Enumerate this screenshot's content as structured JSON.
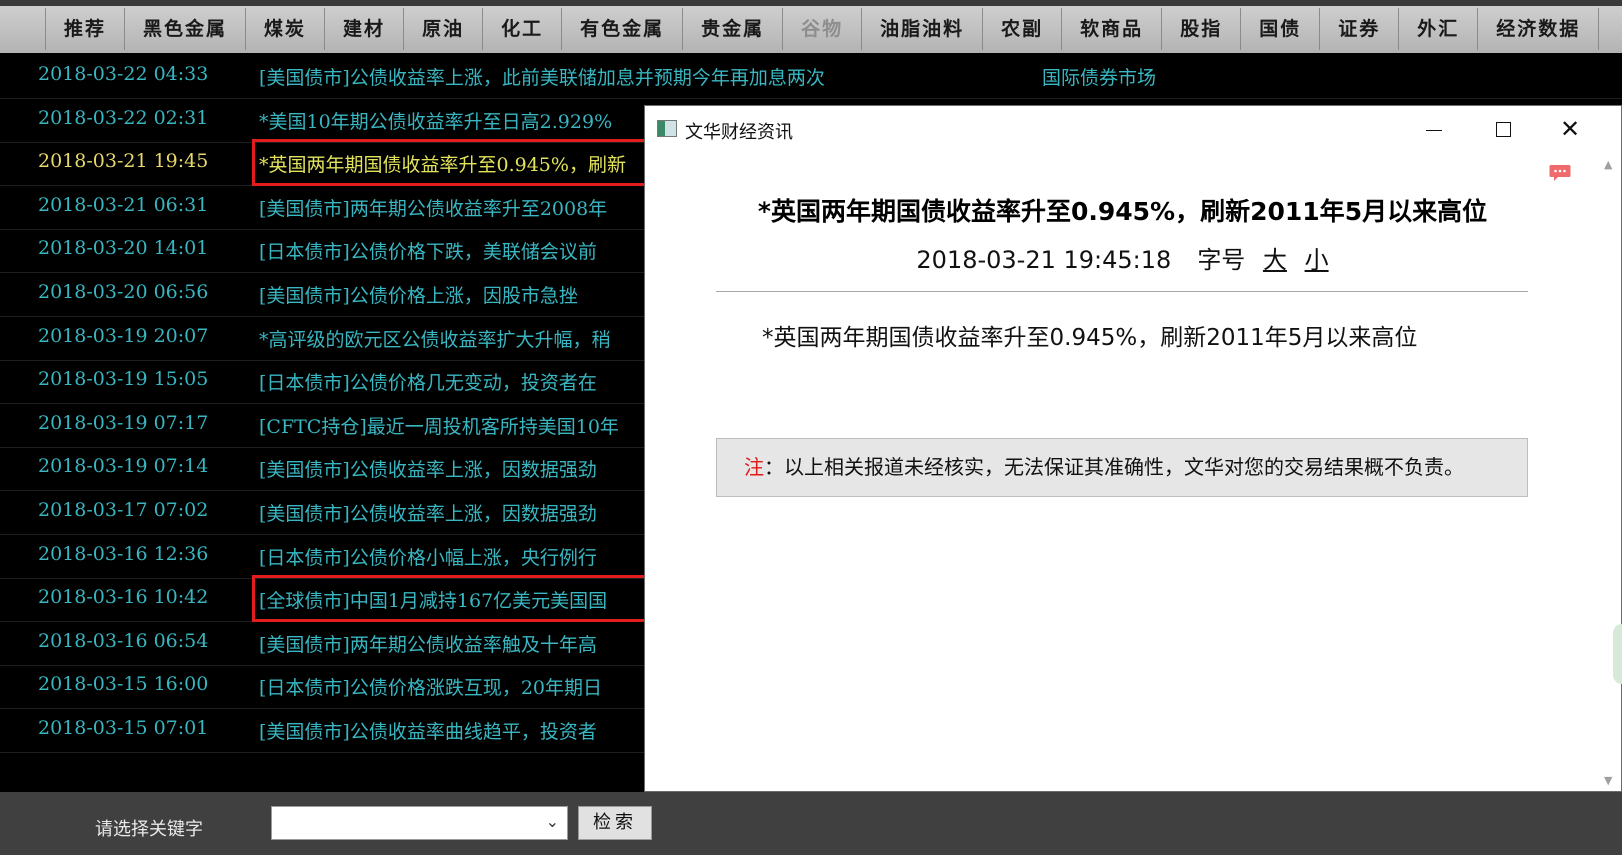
{
  "tabs": [
    {
      "label": "推荐",
      "enabled": true
    },
    {
      "label": "黑色金属",
      "enabled": true
    },
    {
      "label": "煤炭",
      "enabled": true
    },
    {
      "label": "建材",
      "enabled": true
    },
    {
      "label": "原油",
      "enabled": true
    },
    {
      "label": "化工",
      "enabled": true
    },
    {
      "label": "有色金属",
      "enabled": true
    },
    {
      "label": "贵金属",
      "enabled": true
    },
    {
      "label": "谷物",
      "enabled": false
    },
    {
      "label": "油脂油料",
      "enabled": true
    },
    {
      "label": "农副",
      "enabled": true
    },
    {
      "label": "软商品",
      "enabled": true
    },
    {
      "label": "股指",
      "enabled": true
    },
    {
      "label": "国债",
      "enabled": true
    },
    {
      "label": "证券",
      "enabled": true
    },
    {
      "label": "外汇",
      "enabled": true
    },
    {
      "label": "经济数据",
      "enabled": true
    }
  ],
  "news": [
    {
      "time": "2018-03-22 04:33",
      "headline": "[美国债市]公债收益率上涨，此前美联储加息并预期今年再加息两次",
      "category": "国际债券市场"
    },
    {
      "time": "2018-03-22 02:31",
      "headline": "*美国10年期公债收益率升至日高2.929%",
      "category": ""
    },
    {
      "time": "2018-03-21 19:45",
      "headline": "*英国两年期国债收益率升至0.945%，刷新",
      "category": ""
    },
    {
      "time": "2018-03-21 06:31",
      "headline": "[美国债市]两年期公债收益率升至2008年",
      "category": ""
    },
    {
      "time": "2018-03-20 14:01",
      "headline": "[日本债市]公债价格下跌，美联储会议前",
      "category": ""
    },
    {
      "time": "2018-03-20 06:56",
      "headline": "[美国债市]公债价格上涨，因股市急挫",
      "category": ""
    },
    {
      "time": "2018-03-19 20:07",
      "headline": "*高评级的欧元区公债收益率扩大升幅，稍",
      "category": ""
    },
    {
      "time": "2018-03-19 15:05",
      "headline": "[日本债市]公债价格几无变动，投资者在",
      "category": ""
    },
    {
      "time": "2018-03-19 07:17",
      "headline": "[CFTC持仓]最近一周投机客所持美国10年",
      "category": ""
    },
    {
      "time": "2018-03-19 07:14",
      "headline": "[美国债市]公债收益率上涨，因数据强劲",
      "category": ""
    },
    {
      "time": "2018-03-17 07:02",
      "headline": "[美国债市]公债收益率上涨，因数据强劲",
      "category": ""
    },
    {
      "time": "2018-03-16 12:36",
      "headline": "[日本债市]公债价格小幅上涨，央行例行",
      "category": ""
    },
    {
      "time": "2018-03-16 10:42",
      "headline": "[全球债市]中国1月减持167亿美元美国国",
      "category": ""
    },
    {
      "time": "2018-03-16 06:54",
      "headline": "[美国债市]两年期公债收益率触及十年高",
      "category": ""
    },
    {
      "time": "2018-03-15 16:00",
      "headline": "[日本债市]公债价格涨跌互现，20年期日",
      "category": ""
    },
    {
      "time": "2018-03-15 07:01",
      "headline": "[美国债市]公债收益率曲线趋平，投资者",
      "category": ""
    }
  ],
  "selected_index": 2,
  "bottom": {
    "keyword_label": "请选择关键字",
    "keyword_value": "",
    "search_label": "检索"
  },
  "popup": {
    "window_title": "文华财经资讯",
    "title": "*英国两年期国债收益率升至0.945%，刷新2011年5月以来高位",
    "datetime": "2018-03-21 19:45:18",
    "font_label": "字号",
    "font_large": "大",
    "font_small": "小",
    "body": "*英国两年期国债收益率升至0.945%，刷新2011年5月以来高位",
    "note_prefix": "注",
    "note_text": "：以上相关报道未经核实，无法保证其准确性，文华对您的交易结果概不负责。"
  },
  "colors": {
    "news_text": "#38b6c1",
    "selected_text": "#e2e35a",
    "highlight_box": "#e11d1d",
    "note_red": "#e01818"
  }
}
